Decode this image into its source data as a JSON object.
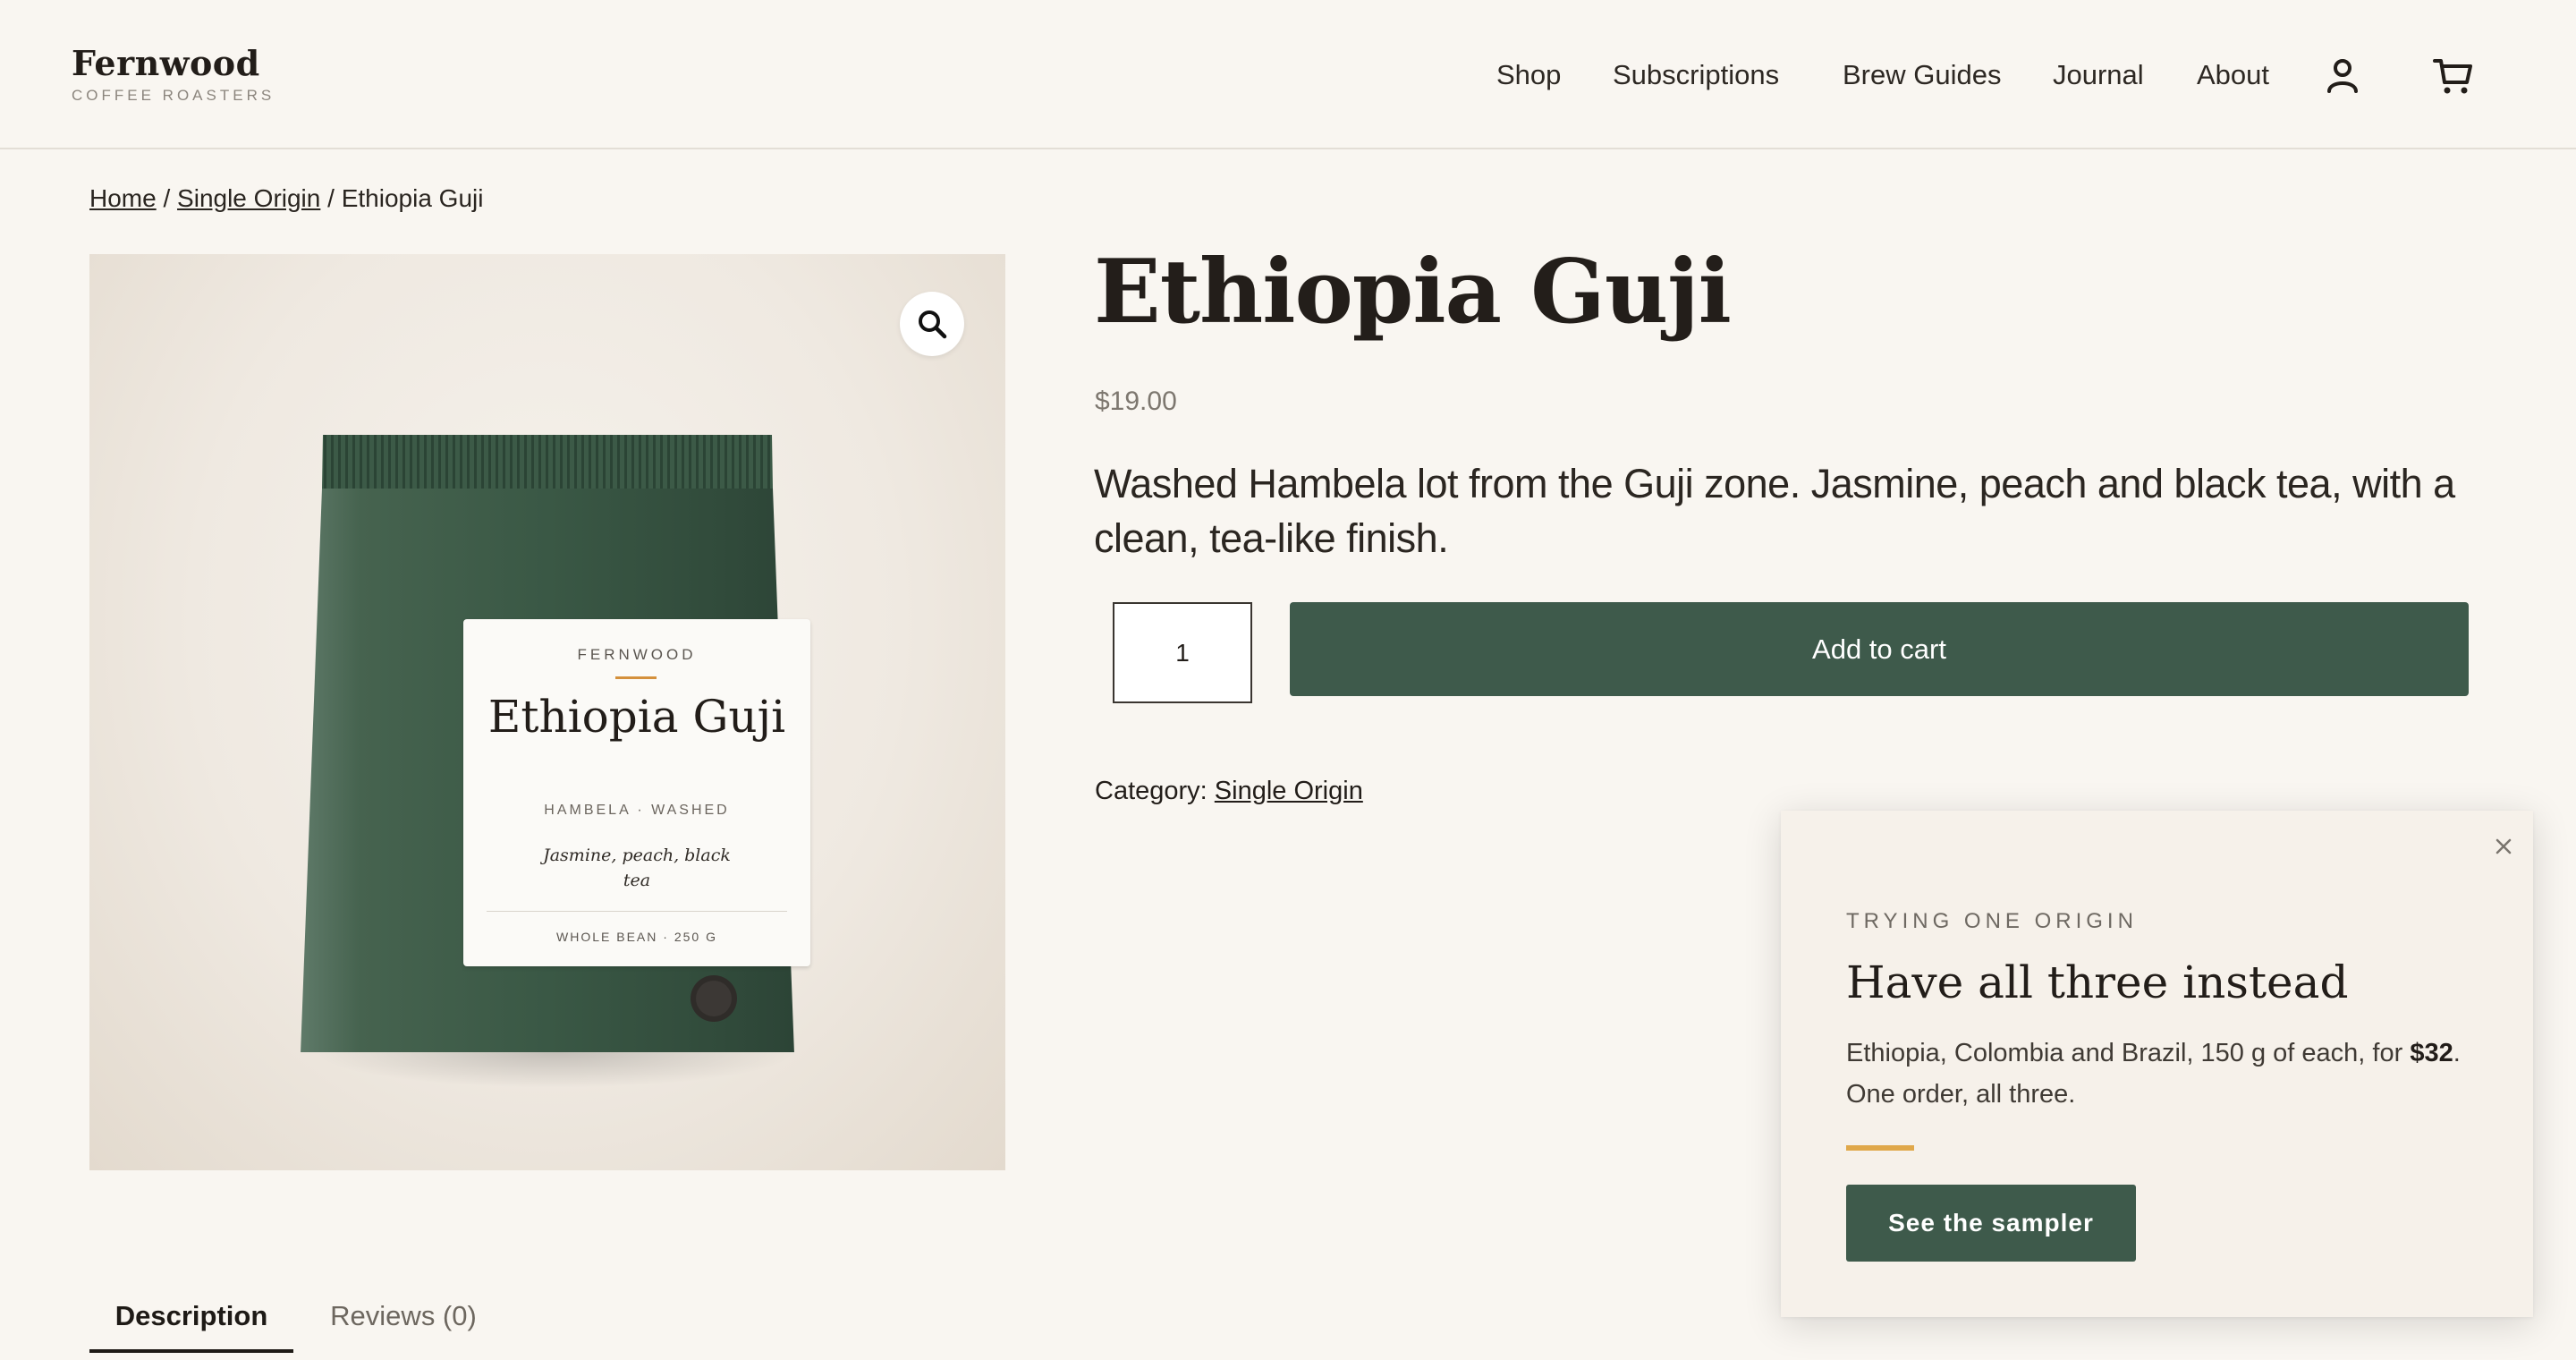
{
  "header": {
    "brand_name": "Fernwood",
    "brand_tagline": "COFFEE ROASTERS",
    "nav": [
      {
        "label": "Shop"
      },
      {
        "label": "Subscriptions"
      },
      {
        "label": "Brew Guides"
      },
      {
        "label": "Journal"
      },
      {
        "label": "About"
      }
    ],
    "account_icon": "user-icon",
    "cart_icon": "cart-icon"
  },
  "breadcrumb": {
    "home": "Home",
    "category": "Single Origin",
    "separator": " / ",
    "current": "Ethiopia Guji"
  },
  "gallery": {
    "zoom_icon": "magnifier-icon",
    "bag_label": {
      "brand": "FERNWOOD",
      "name": "Ethiopia Guji",
      "process": "HAMBELA · WASHED",
      "notes": "Jasmine, peach, black tea",
      "weight": "WHOLE BEAN · 250 G"
    }
  },
  "product": {
    "title": "Ethiopia Guji",
    "price": "$19.00",
    "description": "Washed Hambela lot from the Guji zone. Jasmine, peach and black tea, with a clean, tea-like finish.",
    "quantity": "1",
    "add_to_cart_label": "Add to cart",
    "category_label": "Category:",
    "category_value": "Single Origin"
  },
  "tabs": [
    {
      "label": "Description",
      "active": true
    },
    {
      "label": "Reviews (0)",
      "active": false
    }
  ],
  "popup": {
    "close_icon": "close-icon",
    "eyebrow": "TRYING ONE ORIGIN",
    "title": "Have all three instead",
    "body_lead": "Ethiopia, Colombia and Brazil, 150 g of each, for ",
    "body_price": "$32",
    "body_tail": ". One order, all three.",
    "cta_label": "See the sampler"
  },
  "colors": {
    "background": "#f9f6f1",
    "brand_green": "#3e5a4b",
    "accent_orange": "#e0a84a",
    "text_dark": "#221d19"
  }
}
